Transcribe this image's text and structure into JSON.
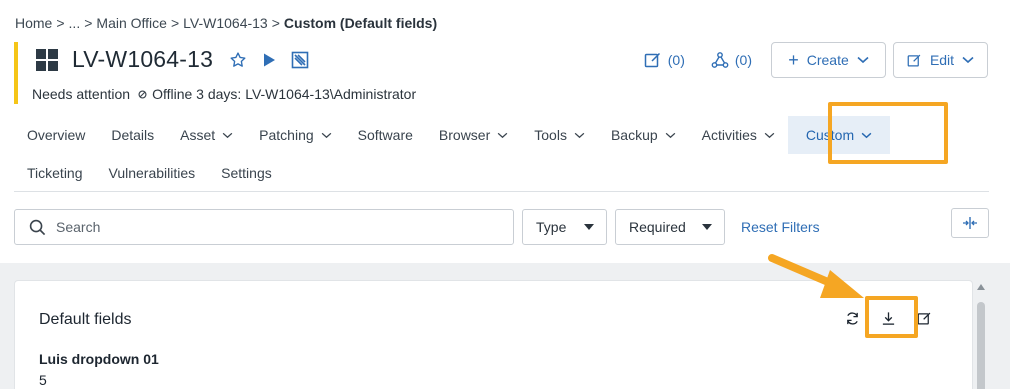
{
  "breadcrumb": {
    "items": [
      "Home",
      "...",
      "Main Office",
      "LV-W1064-13"
    ],
    "separator": ">",
    "current": "Custom (Default fields)"
  },
  "header": {
    "title": "LV-W1064-13",
    "status": "Needs attention",
    "offline_text": "Offline 3 days: LV-W1064-13\\Administrator",
    "notes_count": "(0)",
    "relations_count": "(0)",
    "create_label": "Create",
    "edit_label": "Edit",
    "accent_color": "#f5c518",
    "link_color": "#2f6eb5"
  },
  "tabs": {
    "row1": [
      {
        "label": "Overview",
        "dropdown": false
      },
      {
        "label": "Details",
        "dropdown": false
      },
      {
        "label": "Asset",
        "dropdown": true
      },
      {
        "label": "Patching",
        "dropdown": true
      },
      {
        "label": "Software",
        "dropdown": false
      },
      {
        "label": "Browser",
        "dropdown": true
      },
      {
        "label": "Tools",
        "dropdown": true
      },
      {
        "label": "Backup",
        "dropdown": true
      },
      {
        "label": "Activities",
        "dropdown": true
      },
      {
        "label": "Custom",
        "dropdown": true,
        "active": true
      }
    ],
    "row2": [
      {
        "label": "Ticketing"
      },
      {
        "label": "Vulnerabilities"
      },
      {
        "label": "Settings"
      }
    ]
  },
  "filters": {
    "search_placeholder": "Search",
    "type_label": "Type",
    "required_label": "Required",
    "reset_label": "Reset Filters"
  },
  "card": {
    "title": "Default fields",
    "fields": [
      {
        "label": "Luis dropdown 01",
        "value": "5"
      }
    ]
  },
  "annotations": {
    "highlight_color": "#f5a623"
  }
}
